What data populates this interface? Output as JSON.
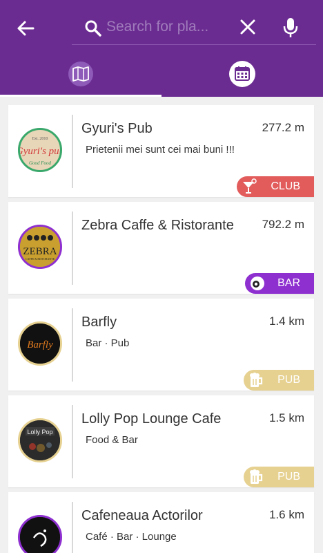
{
  "header": {
    "search_placeholder": "Search for pla...",
    "colors": {
      "primary": "#6b2c91",
      "secondary": "#8e5bb8"
    }
  },
  "tabs": [
    {
      "name": "map",
      "icon": "map-icon",
      "selected": true
    },
    {
      "name": "calendar",
      "icon": "calendar-icon",
      "selected": false
    }
  ],
  "places": [
    {
      "name": "Gyuri's Pub",
      "distance": "277.2 m",
      "subtitle": "Prietenii mei sunt cei mai buni !!!",
      "category": "CLUB",
      "category_icon": "cocktail-icon",
      "category_color": "#e25c5c",
      "logo_text": "Gyuri's pub",
      "logo_extra_top": "Est. 2010",
      "logo_extra_bottom": "Good Food"
    },
    {
      "name": "Zebra Caffe & Ristorante",
      "distance": "792.2 m",
      "subtitle": "",
      "category": "BAR",
      "category_icon": "billiard-ball-icon",
      "category_color": "#8e2fd0",
      "logo_text": "ZEBRA",
      "logo_extra_bottom": "CAFFE & RISTORANTE"
    },
    {
      "name": "Barfly",
      "distance": "1.4 km",
      "subtitle": "Bar · Pub",
      "category": "PUB",
      "category_icon": "beer-mug-icon",
      "category_color": "#e6d191",
      "logo_text": "Barfly"
    },
    {
      "name": "Lolly Pop  Lounge Cafe",
      "distance": "1.5 km",
      "subtitle": "Food & Bar",
      "category": "PUB",
      "category_icon": "beer-mug-icon",
      "category_color": "#e6d191",
      "logo_text": "Lolly Pop"
    },
    {
      "name": "Cafeneaua Actorilor",
      "distance": "1.6 km",
      "subtitle": "Café · Bar · Lounge",
      "category": "",
      "category_icon": "",
      "category_color": "",
      "logo_text": ""
    }
  ]
}
